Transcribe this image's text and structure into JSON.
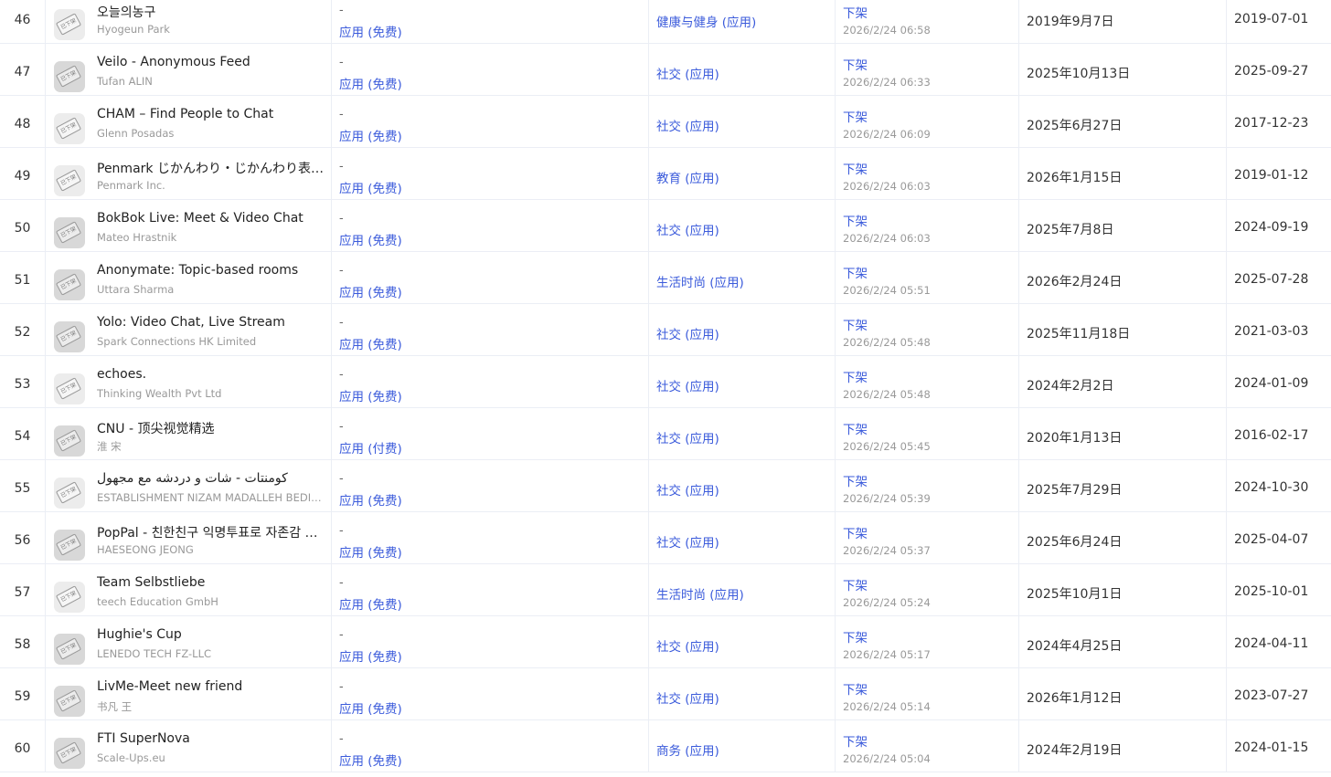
{
  "icon_stamp_text": "已下架",
  "store_badge": "A",
  "rows": [
    {
      "index": "46",
      "name": "오늘의농구",
      "developer": "Hyogeun Park",
      "dash": "-",
      "price": "应用 (免费)",
      "category": "健康与健身 (应用)",
      "status": "下架",
      "status_time": "2026/2/24 06:58",
      "date1": "2019年9月7日",
      "date2": "2019-07-01"
    },
    {
      "index": "47",
      "name": "Veilo - Anonymous Feed",
      "developer": "Tufan ALIN",
      "dash": "-",
      "price": "应用 (免费)",
      "category": "社交 (应用)",
      "status": "下架",
      "status_time": "2026/2/24 06:33",
      "date1": "2025年10月13日",
      "date2": "2025-09-27"
    },
    {
      "index": "48",
      "name": "CHAM – Find People to Chat",
      "developer": "Glenn Posadas",
      "dash": "-",
      "price": "应用 (免费)",
      "category": "社交 (应用)",
      "status": "下架",
      "status_time": "2026/2/24 06:09",
      "date1": "2025年6月27日",
      "date2": "2017-12-23"
    },
    {
      "index": "49",
      "name": "Penmark じかんわり・じかんわり表…",
      "developer": "Penmark Inc.",
      "dash": "-",
      "price": "应用 (免费)",
      "category": "教育 (应用)",
      "status": "下架",
      "status_time": "2026/2/24 06:03",
      "date1": "2026年1月15日",
      "date2": "2019-01-12"
    },
    {
      "index": "50",
      "name": "BokBok Live: Meet & Video Chat",
      "developer": "Mateo Hrastnik",
      "dash": "-",
      "price": "应用 (免费)",
      "category": "社交 (应用)",
      "status": "下架",
      "status_time": "2026/2/24 06:03",
      "date1": "2025年7月8日",
      "date2": "2024-09-19"
    },
    {
      "index": "51",
      "name": "Anonymate: Topic-based rooms",
      "developer": "Uttara Sharma",
      "dash": "-",
      "price": "应用 (免费)",
      "category": "生活时尚 (应用)",
      "status": "下架",
      "status_time": "2026/2/24 05:51",
      "date1": "2026年2月24日",
      "date2": "2025-07-28"
    },
    {
      "index": "52",
      "name": "Yolo: Video Chat, Live Stream",
      "developer": "Spark Connections HK Limited",
      "dash": "-",
      "price": "应用 (免费)",
      "category": "社交 (应用)",
      "status": "下架",
      "status_time": "2026/2/24 05:48",
      "date1": "2025年11月18日",
      "date2": "2021-03-03"
    },
    {
      "index": "53",
      "name": "echoes.",
      "developer": "Thinking Wealth Pvt Ltd",
      "dash": "-",
      "price": "应用 (免费)",
      "category": "社交 (应用)",
      "status": "下架",
      "status_time": "2026/2/24 05:48",
      "date1": "2024年2月2日",
      "date2": "2024-01-09"
    },
    {
      "index": "54",
      "name": "CNU - 顶尖视觉精选",
      "developer": "淮 宋",
      "dash": "-",
      "price": "应用 (付费)",
      "category": "社交 (应用)",
      "status": "下架",
      "status_time": "2026/2/24 05:45",
      "date1": "2020年1月13日",
      "date2": "2016-02-17"
    },
    {
      "index": "55",
      "name": "كومنتات - شات و دردشه مع مجهول",
      "developer": "ESTABLISHMENT NIZAM MADALLEH BEDI…",
      "dash": "-",
      "price": "应用 (免费)",
      "category": "社交 (应用)",
      "status": "下架",
      "status_time": "2026/2/24 05:39",
      "date1": "2025年7月29日",
      "date2": "2024-10-30"
    },
    {
      "index": "56",
      "name": "PopPal - 친한친구 익명투표로 자존감 …",
      "developer": "HAESEONG JEONG",
      "dash": "-",
      "price": "应用 (免费)",
      "category": "社交 (应用)",
      "status": "下架",
      "status_time": "2026/2/24 05:37",
      "date1": "2025年6月24日",
      "date2": "2025-04-07"
    },
    {
      "index": "57",
      "name": "Team Selbstliebe",
      "developer": "teech Education GmbH",
      "dash": "-",
      "price": "应用 (免费)",
      "category": "生活时尚 (应用)",
      "status": "下架",
      "status_time": "2026/2/24 05:24",
      "date1": "2025年10月1日",
      "date2": "2025-10-01"
    },
    {
      "index": "58",
      "name": "Hughie's Cup",
      "developer": "LENEDO TECH FZ-LLC",
      "dash": "-",
      "price": "应用 (免费)",
      "category": "社交 (应用)",
      "status": "下架",
      "status_time": "2026/2/24 05:17",
      "date1": "2024年4月25日",
      "date2": "2024-04-11"
    },
    {
      "index": "59",
      "name": "LivMe-Meet new friend",
      "developer": "书凡 王",
      "dash": "-",
      "price": "应用 (免费)",
      "category": "社交 (应用)",
      "status": "下架",
      "status_time": "2026/2/24 05:14",
      "date1": "2026年1月12日",
      "date2": "2023-07-27"
    },
    {
      "index": "60",
      "name": "FTI SuperNova",
      "developer": "Scale-Ups.eu",
      "dash": "-",
      "price": "应用 (免费)",
      "category": "商务 (应用)",
      "status": "下架",
      "status_time": "2026/2/24 05:04",
      "date1": "2024年2月19日",
      "date2": "2024-01-15"
    }
  ]
}
